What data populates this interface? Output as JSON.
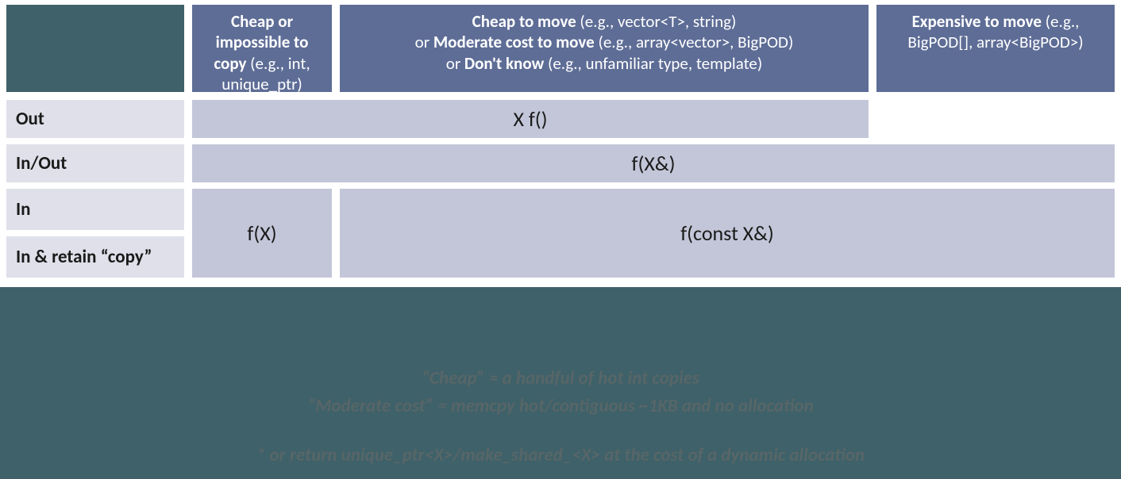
{
  "headers": {
    "a_bold": "Cheap or impossible to copy",
    "a_eg": " (e.g., int, unique_ptr)",
    "b_bold1": "Cheap to move",
    "b_eg1": " (e.g., vector<T>, string)",
    "b_pre2": "or ",
    "b_bold2": "Moderate cost to move",
    "b_eg2": " (e.g., array<vector>, BigPOD)",
    "b_pre3": "or ",
    "b_bold3": "Don't know",
    "b_eg3": " (e.g., unfamiliar type, template)",
    "c_bold": "Expensive to move",
    "c_eg": " (e.g., BigPOD[], array<BigPOD>)"
  },
  "rows": {
    "out": "Out",
    "inout": "In/Out",
    "in": "In",
    "inretain": "In & retain “copy”"
  },
  "cells": {
    "out_ab": "X f()",
    "inout_abc": "f(X&)",
    "in_a": "f(X)",
    "in_bc": "f(const X&)"
  },
  "notes": {
    "line1": "“Cheap”  ≈  a handful of hot int copies",
    "line2": "“Moderate cost”  ≈  memcpy hot/contiguous ~1KB and no allocation",
    "line3": "* or return unique_ptr<X>/make_shared_<X> at the cost of a dynamic allocation"
  },
  "chart_data": {
    "type": "table",
    "column_headers": [
      "Cheap or impossible to copy (e.g., int, unique_ptr)",
      "Cheap to move (e.g., vector<T>, string) or Moderate cost to move (e.g., array<vector>, BigPOD) or Don't know (e.g., unfamiliar type, template)",
      "Expensive to move (e.g., BigPOD[], array<BigPOD>)"
    ],
    "row_headers": [
      "Out",
      "In/Out",
      "In",
      "In & retain \"copy\""
    ],
    "cells": [
      [
        "X f()",
        "X f()",
        ""
      ],
      [
        "f(X&)",
        "f(X&)",
        "f(X&)"
      ],
      [
        "f(X)",
        "f(const X&)",
        "f(const X&)"
      ],
      [
        "f(X)",
        "f(const X&)",
        "f(const X&)"
      ]
    ],
    "notes": [
      "\"Cheap\" ≈ a handful of hot int copies",
      "\"Moderate cost\" ≈ memcpy hot/contiguous ~1KB and no allocation",
      "* or return unique_ptr<X>/make_shared_<X> at the cost of a dynamic allocation"
    ]
  }
}
